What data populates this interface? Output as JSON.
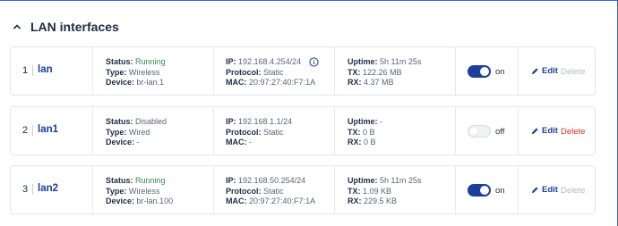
{
  "section": {
    "title": "LAN interfaces"
  },
  "labels": {
    "status": "Status:",
    "type": "Type:",
    "device": "Device:",
    "ip": "IP:",
    "protocol": "Protocol:",
    "mac": "MAC:",
    "uptime": "Uptime:",
    "tx": "TX:",
    "rx": "RX:",
    "edit": "Edit",
    "delete": "Delete"
  },
  "interfaces": [
    {
      "index": "1",
      "name": "lan",
      "status": "Running",
      "type": "Wireless",
      "device": "br-lan.1",
      "ip": "192.168.4.254/24",
      "protocol": "Static",
      "mac": "20:97:27:40:F7:1A",
      "uptime": "5h 11m 25s",
      "tx": "122.26 MB",
      "rx": "4.37 MB",
      "toggle": "on",
      "toggle_state": true,
      "delete_enabled": false
    },
    {
      "index": "2",
      "name": "lan1",
      "status": "Disabled",
      "type": "Wired",
      "device": "-",
      "ip": "192.168.1.1/24",
      "protocol": "Static",
      "mac": "-",
      "uptime": "-",
      "tx": "0 B",
      "rx": "0 B",
      "toggle": "off",
      "toggle_state": false,
      "delete_enabled": true
    },
    {
      "index": "3",
      "name": "lan2",
      "status": "Running",
      "type": "Wireless",
      "device": "br-lan.100",
      "ip": "192.168.50.254/24",
      "protocol": "Static",
      "mac": "20:97:27:40:F7:1A",
      "uptime": "5h 11m 25s",
      "tx": "1.09 KB",
      "rx": "229.5 KB",
      "toggle": "on",
      "toggle_state": true,
      "delete_enabled": false
    }
  ],
  "colors": {
    "accent": "#1c3f9c",
    "running": "#2e8b57",
    "delete": "#d0342c",
    "disabled": "#b4b9c4"
  }
}
